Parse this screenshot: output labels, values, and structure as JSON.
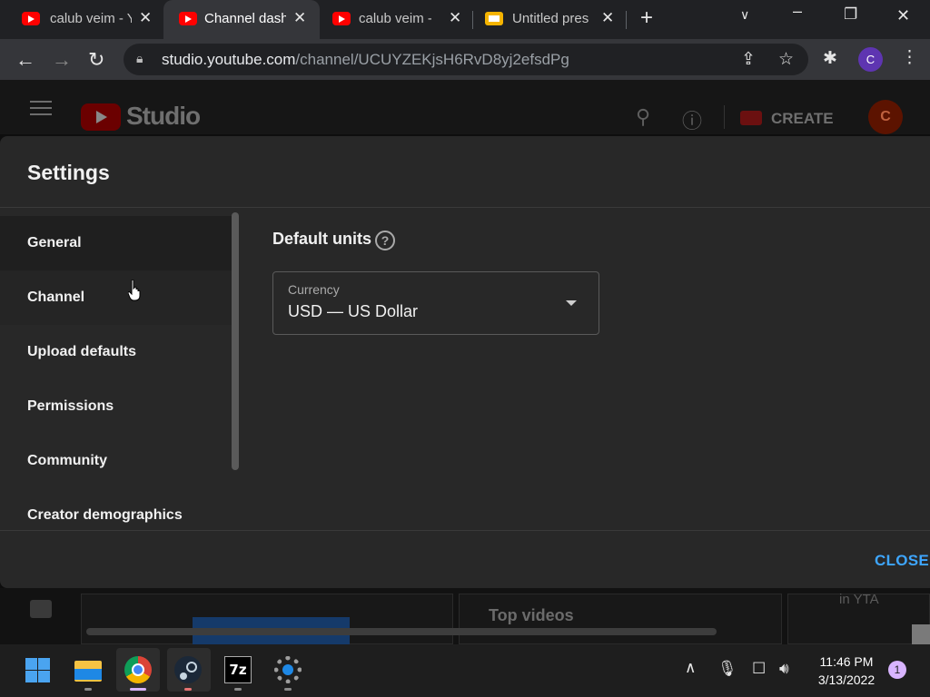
{
  "browser": {
    "tabs": [
      {
        "title": "calub veim - YouTube",
        "favicon": "youtube-icon",
        "active": false
      },
      {
        "title": "Channel dashboard",
        "favicon": "youtube-icon",
        "active": true
      },
      {
        "title": "calub veim - YouTube",
        "favicon": "youtube-icon",
        "active": false
      },
      {
        "title": "Untitled presentation",
        "favicon": "slides-icon",
        "active": false
      }
    ],
    "url_host": "studio.youtube.com",
    "url_path": "/channel/UCUYZEKjsH6RvD8yj2efsdPg",
    "profile_initial": "C"
  },
  "studio": {
    "logo_text": "Studio",
    "create_label": "CREATE",
    "avatar_initial": "C",
    "background_texts": {
      "top_videos": "Top videos",
      "in_yta": "in YTA"
    }
  },
  "settings": {
    "title": "Settings",
    "nav_items": [
      "General",
      "Channel",
      "Upload defaults",
      "Permissions",
      "Community",
      "Creator demographics"
    ],
    "selected": "General",
    "section_title": "Default units",
    "help_icon": "?",
    "currency_label": "Currency",
    "currency_value": "USD — US Dollar",
    "close_label": "CLOSE"
  },
  "taskbar": {
    "time": "11:46 PM",
    "date": "3/13/2022",
    "notifications": "1"
  },
  "colors": {
    "accent_blue": "#3ea6ff",
    "youtube_red": "#ff0000"
  }
}
